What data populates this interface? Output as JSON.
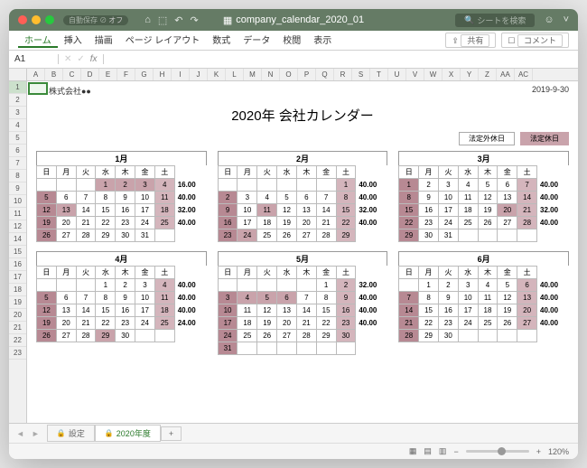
{
  "window": {
    "filename": "company_calendar_2020_01",
    "search_placeholder": "シートを検索",
    "autosave": "自動保存"
  },
  "ribbon": {
    "tabs": [
      "ホーム",
      "挿入",
      "描画",
      "ページ レイアウト",
      "数式",
      "データ",
      "校閲",
      "表示"
    ],
    "share": "共有",
    "comment": "コメント"
  },
  "cell_ref": "A1",
  "columns": [
    "A",
    "B",
    "C",
    "D",
    "E",
    "F",
    "G",
    "H",
    "I",
    "J",
    "K",
    "L",
    "M",
    "N",
    "O",
    "P",
    "Q",
    "R",
    "S",
    "T",
    "U",
    "V",
    "W",
    "X",
    "Y",
    "Z",
    "AA",
    "AC"
  ],
  "rows": [
    "1",
    "2",
    "3",
    "4",
    "5",
    "6",
    "7",
    "8",
    "9",
    "10",
    "11",
    "12",
    "14",
    "15",
    "16",
    "17",
    "18",
    "19",
    "20",
    "21",
    "22",
    "23"
  ],
  "company": "株式会社●●",
  "date": "2019-9-30",
  "title": "2020年 会社カレンダー",
  "legend": {
    "a": "法定外休日",
    "b": "法定休日"
  },
  "days": [
    "日",
    "月",
    "火",
    "水",
    "木",
    "金",
    "土"
  ],
  "months": [
    {
      "name": "1月",
      "values": [
        "16.00",
        "40.00",
        "32.00",
        "40.00"
      ],
      "weeks": [
        [
          null,
          null,
          null,
          {
            "d": 1,
            "c": "holiday"
          },
          {
            "d": 2,
            "c": "holiday"
          },
          {
            "d": 3,
            "c": "holiday"
          },
          {
            "d": 4,
            "c": "sun2"
          }
        ],
        [
          {
            "d": 5,
            "c": "sun"
          },
          {
            "d": 6
          },
          {
            "d": 7
          },
          {
            "d": 8
          },
          {
            "d": 9
          },
          {
            "d": 10
          },
          {
            "d": 11,
            "c": "sun2"
          }
        ],
        [
          {
            "d": 12,
            "c": "sun"
          },
          {
            "d": 13,
            "c": "holiday"
          },
          {
            "d": 14
          },
          {
            "d": 15
          },
          {
            "d": 16
          },
          {
            "d": 17
          },
          {
            "d": 18,
            "c": "sun2"
          }
        ],
        [
          {
            "d": 19,
            "c": "sun"
          },
          {
            "d": 20
          },
          {
            "d": 21
          },
          {
            "d": 22
          },
          {
            "d": 23
          },
          {
            "d": 24
          },
          {
            "d": 25,
            "c": "sun2"
          }
        ],
        [
          {
            "d": 26,
            "c": "sun"
          },
          {
            "d": 27
          },
          {
            "d": 28
          },
          {
            "d": 29
          },
          {
            "d": 30
          },
          {
            "d": 31
          },
          null
        ]
      ]
    },
    {
      "name": "2月",
      "values": [
        "40.00",
        "40.00",
        "32.00",
        "40.00"
      ],
      "weeks": [
        [
          null,
          null,
          null,
          null,
          null,
          null,
          {
            "d": 1,
            "c": "sun2"
          }
        ],
        [
          {
            "d": 2,
            "c": "sun"
          },
          {
            "d": 3
          },
          {
            "d": 4
          },
          {
            "d": 5
          },
          {
            "d": 6
          },
          {
            "d": 7
          },
          {
            "d": 8,
            "c": "sun2"
          }
        ],
        [
          {
            "d": 9,
            "c": "sun"
          },
          {
            "d": 10
          },
          {
            "d": 11,
            "c": "holiday"
          },
          {
            "d": 12
          },
          {
            "d": 13
          },
          {
            "d": 14
          },
          {
            "d": 15,
            "c": "sun2"
          }
        ],
        [
          {
            "d": 16,
            "c": "sun"
          },
          {
            "d": 17
          },
          {
            "d": 18
          },
          {
            "d": 19
          },
          {
            "d": 20
          },
          {
            "d": 21
          },
          {
            "d": 22,
            "c": "sun2"
          }
        ],
        [
          {
            "d": 23,
            "c": "sun"
          },
          {
            "d": 24,
            "c": "holiday"
          },
          {
            "d": 25
          },
          {
            "d": 26
          },
          {
            "d": 27
          },
          {
            "d": 28
          },
          {
            "d": 29,
            "c": "sun2"
          }
        ]
      ]
    },
    {
      "name": "3月",
      "values": [
        "40.00",
        "40.00",
        "32.00",
        "40.00"
      ],
      "weeks": [
        [
          {
            "d": 1,
            "c": "sun"
          },
          {
            "d": 2
          },
          {
            "d": 3
          },
          {
            "d": 4
          },
          {
            "d": 5
          },
          {
            "d": 6
          },
          {
            "d": 7,
            "c": "sun2"
          }
        ],
        [
          {
            "d": 8,
            "c": "sun"
          },
          {
            "d": 9
          },
          {
            "d": 10
          },
          {
            "d": 11
          },
          {
            "d": 12
          },
          {
            "d": 13
          },
          {
            "d": 14,
            "c": "sun2"
          }
        ],
        [
          {
            "d": 15,
            "c": "sun"
          },
          {
            "d": 16
          },
          {
            "d": 17
          },
          {
            "d": 18
          },
          {
            "d": 19
          },
          {
            "d": 20,
            "c": "holiday"
          },
          {
            "d": 21,
            "c": "sun2"
          }
        ],
        [
          {
            "d": 22,
            "c": "sun"
          },
          {
            "d": 23
          },
          {
            "d": 24
          },
          {
            "d": 25
          },
          {
            "d": 26
          },
          {
            "d": 27
          },
          {
            "d": 28,
            "c": "sun2"
          }
        ],
        [
          {
            "d": 29,
            "c": "sun"
          },
          {
            "d": 30
          },
          {
            "d": 31
          },
          null,
          null,
          null,
          null
        ]
      ]
    },
    {
      "name": "4月",
      "values": [
        "40.00",
        "40.00",
        "40.00",
        "24.00"
      ],
      "weeks": [
        [
          null,
          null,
          null,
          {
            "d": 1
          },
          {
            "d": 2
          },
          {
            "d": 3
          },
          {
            "d": 4,
            "c": "sun2"
          }
        ],
        [
          {
            "d": 5,
            "c": "sun"
          },
          {
            "d": 6
          },
          {
            "d": 7
          },
          {
            "d": 8
          },
          {
            "d": 9
          },
          {
            "d": 10
          },
          {
            "d": 11,
            "c": "sun2"
          }
        ],
        [
          {
            "d": 12,
            "c": "sun"
          },
          {
            "d": 13
          },
          {
            "d": 14
          },
          {
            "d": 15
          },
          {
            "d": 16
          },
          {
            "d": 17
          },
          {
            "d": 18,
            "c": "sun2"
          }
        ],
        [
          {
            "d": 19,
            "c": "sun"
          },
          {
            "d": 20
          },
          {
            "d": 21
          },
          {
            "d": 22
          },
          {
            "d": 23
          },
          {
            "d": 24
          },
          {
            "d": 25,
            "c": "sun2"
          }
        ],
        [
          {
            "d": 26,
            "c": "sun"
          },
          {
            "d": 27
          },
          {
            "d": 28
          },
          {
            "d": 29,
            "c": "holiday"
          },
          {
            "d": 30
          },
          null,
          null
        ]
      ]
    },
    {
      "name": "5月",
      "values": [
        "32.00",
        "40.00",
        "40.00",
        "40.00"
      ],
      "weeks": [
        [
          null,
          null,
          null,
          null,
          null,
          {
            "d": 1
          },
          {
            "d": 2,
            "c": "sun2"
          }
        ],
        [
          {
            "d": 3,
            "c": "sun"
          },
          {
            "d": 4,
            "c": "holiday"
          },
          {
            "d": 5,
            "c": "holiday"
          },
          {
            "d": 6,
            "c": "holiday"
          },
          {
            "d": 7
          },
          {
            "d": 8
          },
          {
            "d": 9,
            "c": "sun2"
          }
        ],
        [
          {
            "d": 10,
            "c": "sun"
          },
          {
            "d": 11
          },
          {
            "d": 12
          },
          {
            "d": 13
          },
          {
            "d": 14
          },
          {
            "d": 15
          },
          {
            "d": 16,
            "c": "sun2"
          }
        ],
        [
          {
            "d": 17,
            "c": "sun"
          },
          {
            "d": 18
          },
          {
            "d": 19
          },
          {
            "d": 20
          },
          {
            "d": 21
          },
          {
            "d": 22
          },
          {
            "d": 23,
            "c": "sun2"
          }
        ],
        [
          {
            "d": 24,
            "c": "sun"
          },
          {
            "d": 25
          },
          {
            "d": 26
          },
          {
            "d": 27
          },
          {
            "d": 28
          },
          {
            "d": 29
          },
          {
            "d": 30,
            "c": "sun2"
          }
        ],
        [
          {
            "d": 31,
            "c": "sun"
          },
          null,
          null,
          null,
          null,
          null,
          null
        ]
      ]
    },
    {
      "name": "6月",
      "values": [
        "40.00",
        "40.00",
        "40.00",
        "40.00"
      ],
      "weeks": [
        [
          null,
          {
            "d": 1
          },
          {
            "d": 2
          },
          {
            "d": 3
          },
          {
            "d": 4
          },
          {
            "d": 5
          },
          {
            "d": 6,
            "c": "sun2"
          }
        ],
        [
          {
            "d": 7,
            "c": "sun"
          },
          {
            "d": 8
          },
          {
            "d": 9
          },
          {
            "d": 10
          },
          {
            "d": 11
          },
          {
            "d": 12
          },
          {
            "d": 13,
            "c": "sun2"
          }
        ],
        [
          {
            "d": 14,
            "c": "sun"
          },
          {
            "d": 15
          },
          {
            "d": 16
          },
          {
            "d": 17
          },
          {
            "d": 18
          },
          {
            "d": 19
          },
          {
            "d": 20,
            "c": "sun2"
          }
        ],
        [
          {
            "d": 21,
            "c": "sun"
          },
          {
            "d": 22
          },
          {
            "d": 23
          },
          {
            "d": 24
          },
          {
            "d": 25
          },
          {
            "d": 26
          },
          {
            "d": 27,
            "c": "sun2"
          }
        ],
        [
          {
            "d": 28,
            "c": "sun"
          },
          {
            "d": 29
          },
          {
            "d": 30
          },
          null,
          null,
          null,
          null
        ]
      ]
    }
  ],
  "tabs": {
    "settings": "設定",
    "year": "2020年度"
  },
  "zoom": "120%"
}
